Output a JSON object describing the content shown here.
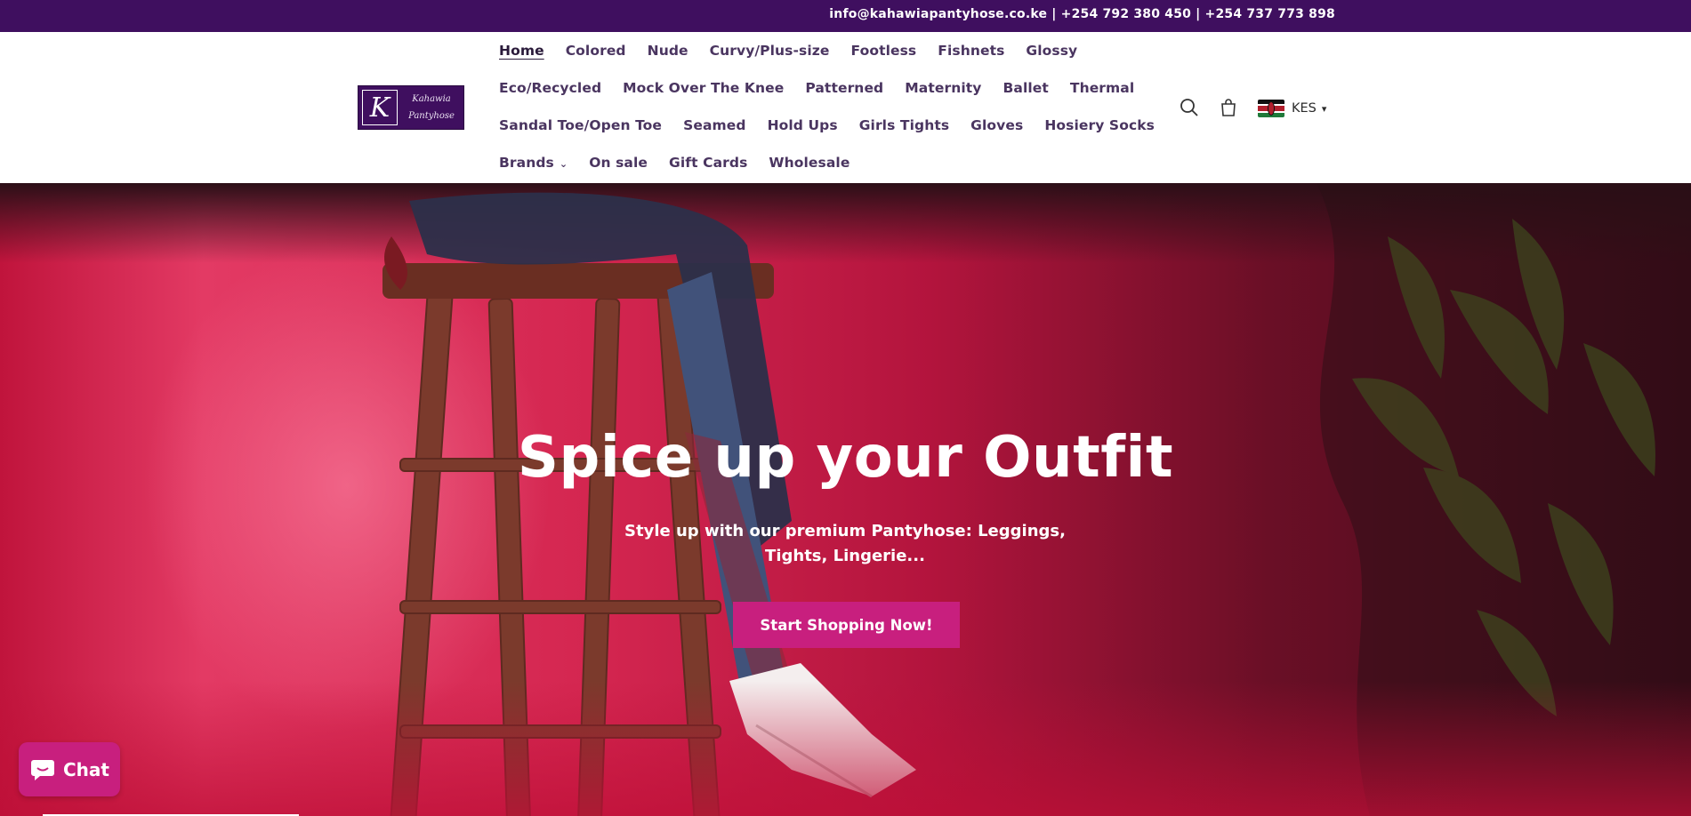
{
  "announcement": {
    "text": "info@kahawiapantyhose.co.ke | +254 792 380 450 | +254 737 773 898"
  },
  "brand": {
    "logo_letter": "K",
    "logo_script_line1": "Kahawia",
    "logo_script_line2": "Pantyhose",
    "color_primary": "#3f0f5f",
    "color_accent": "#c81f7e"
  },
  "nav": {
    "rows": [
      [
        "Home",
        "Colored",
        "Nude",
        "Curvy/Plus-size",
        "Footless",
        "Fishnets",
        "Glossy"
      ],
      [
        "Eco/Recycled",
        "Mock Over The Knee",
        "Patterned",
        "Maternity",
        "Ballet",
        "Thermal"
      ],
      [
        "Sandal Toe/Open Toe",
        "Seamed",
        "Hold Ups",
        "Girls Tights",
        "Gloves",
        "Hosiery Socks"
      ],
      [
        "Brands",
        "On sale",
        "Gift Cards",
        "Wholesale"
      ]
    ],
    "active": "Home",
    "dropdown_item": "Brands"
  },
  "header_icons": {
    "search": "search-icon",
    "cart": "cart-icon"
  },
  "currency": {
    "code": "KES",
    "flag": "kenya-flag-icon"
  },
  "hero": {
    "title": "Spice up your Outfit",
    "subtitle": "Style up with our premium Pantyhose: Leggings, Tights, Lingerie...",
    "cta_label": "Start Shopping Now!"
  },
  "chat": {
    "label": "Chat",
    "icon": "chat-bubble-icon"
  }
}
